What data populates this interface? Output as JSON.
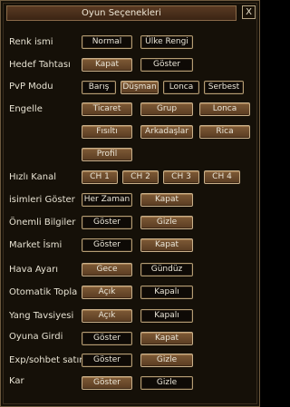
{
  "window": {
    "title": "Oyun Seçenekleri",
    "close_label": "X"
  },
  "rows": {
    "renk": {
      "label": "Renk ismi",
      "opt0": "Normal",
      "opt1": "Ülke Rengi"
    },
    "hedef": {
      "label": "Hedef Tahtası",
      "opt0": "Kapat",
      "opt1": "Göster"
    },
    "pvp": {
      "label": "PvP Modu",
      "opt0": "Barış",
      "opt1": "Düşman",
      "opt2": "Lonca",
      "opt3": "Serbest"
    },
    "engelle": {
      "label": "Engelle",
      "opt0": "Ticaret",
      "opt1": "Grup",
      "opt2": "Lonca",
      "opt3": "Fısıltı",
      "opt4": "Arkadaşlar",
      "opt5": "Rica",
      "opt6": "Profil"
    },
    "kanal": {
      "label": "Hızlı Kanal",
      "opt0": "CH 1",
      "opt1": "CH 2",
      "opt2": "CH 3",
      "opt3": "CH 4"
    },
    "isimler": {
      "label": "isimleri Göster",
      "opt0": "Her Zaman",
      "opt1": "Kapat"
    },
    "onemli": {
      "label": "Önemli Bilgiler",
      "opt0": "Göster",
      "opt1": "Gizle"
    },
    "market": {
      "label": "Market İsmi",
      "opt0": "Göster",
      "opt1": "Kapat"
    },
    "hava": {
      "label": "Hava Ayarı",
      "opt0": "Gece",
      "opt1": "Gündüz"
    },
    "topla": {
      "label": "Otomatik Topla",
      "opt0": "Açık",
      "opt1": "Kapalı"
    },
    "yang": {
      "label": "Yang Tavsiyesi",
      "opt0": "Açık",
      "opt1": "Kapalı"
    },
    "ogirdi": {
      "label": "Oyuna Girdi",
      "opt0": "Göster",
      "opt1": "Kapat"
    },
    "exp": {
      "label": "Exp/sohbet satırı",
      "opt0": "Göster",
      "opt1": "Gizle"
    },
    "kar": {
      "label": "Kar",
      "opt0": "Göster",
      "opt1": "Gizle"
    }
  }
}
